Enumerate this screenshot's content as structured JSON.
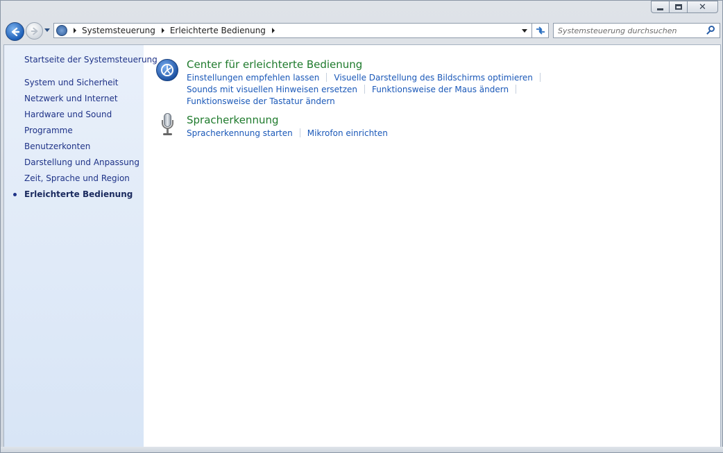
{
  "window": {
    "caption_buttons": [
      "minimize",
      "maximize",
      "close"
    ],
    "close_glyph": "✕"
  },
  "address": {
    "crumbs": [
      "Systemsteuerung",
      "Erleichterte Bedienung"
    ],
    "refresh_glyph": "↹"
  },
  "search": {
    "placeholder": "Systemsteuerung durchsuchen"
  },
  "sidebar": {
    "home": "Startseite der Systemsteuerung",
    "items": [
      {
        "label": "System und Sicherheit",
        "active": false
      },
      {
        "label": "Netzwerk und Internet",
        "active": false
      },
      {
        "label": "Hardware und Sound",
        "active": false
      },
      {
        "label": "Programme",
        "active": false
      },
      {
        "label": "Benutzerkonten",
        "active": false
      },
      {
        "label": "Darstellung und Anpassung",
        "active": false
      },
      {
        "label": "Zeit, Sprache und Region",
        "active": false
      },
      {
        "label": "Erleichterte Bedienung",
        "active": true
      }
    ]
  },
  "main": {
    "categories": [
      {
        "title": "Center für erleichterte Bedienung",
        "icon": "ease-of-access-icon",
        "link_rows": [
          [
            "Einstellungen empfehlen lassen",
            "Visuelle Darstellung des Bildschirms optimieren"
          ],
          [
            "Sounds mit visuellen Hinweisen ersetzen",
            "Funktionsweise der Maus ändern"
          ],
          [
            "Funktionsweise der Tastatur ändern"
          ]
        ]
      },
      {
        "title": "Spracherkennung",
        "icon": "microphone-icon",
        "link_rows": [
          [
            "Spracherkennung starten",
            "Mikrofon einrichten"
          ]
        ]
      }
    ]
  },
  "colors": {
    "sidebar_link": "#1e3287",
    "category_title": "#1e7a2c",
    "task_link": "#1a58b8"
  }
}
